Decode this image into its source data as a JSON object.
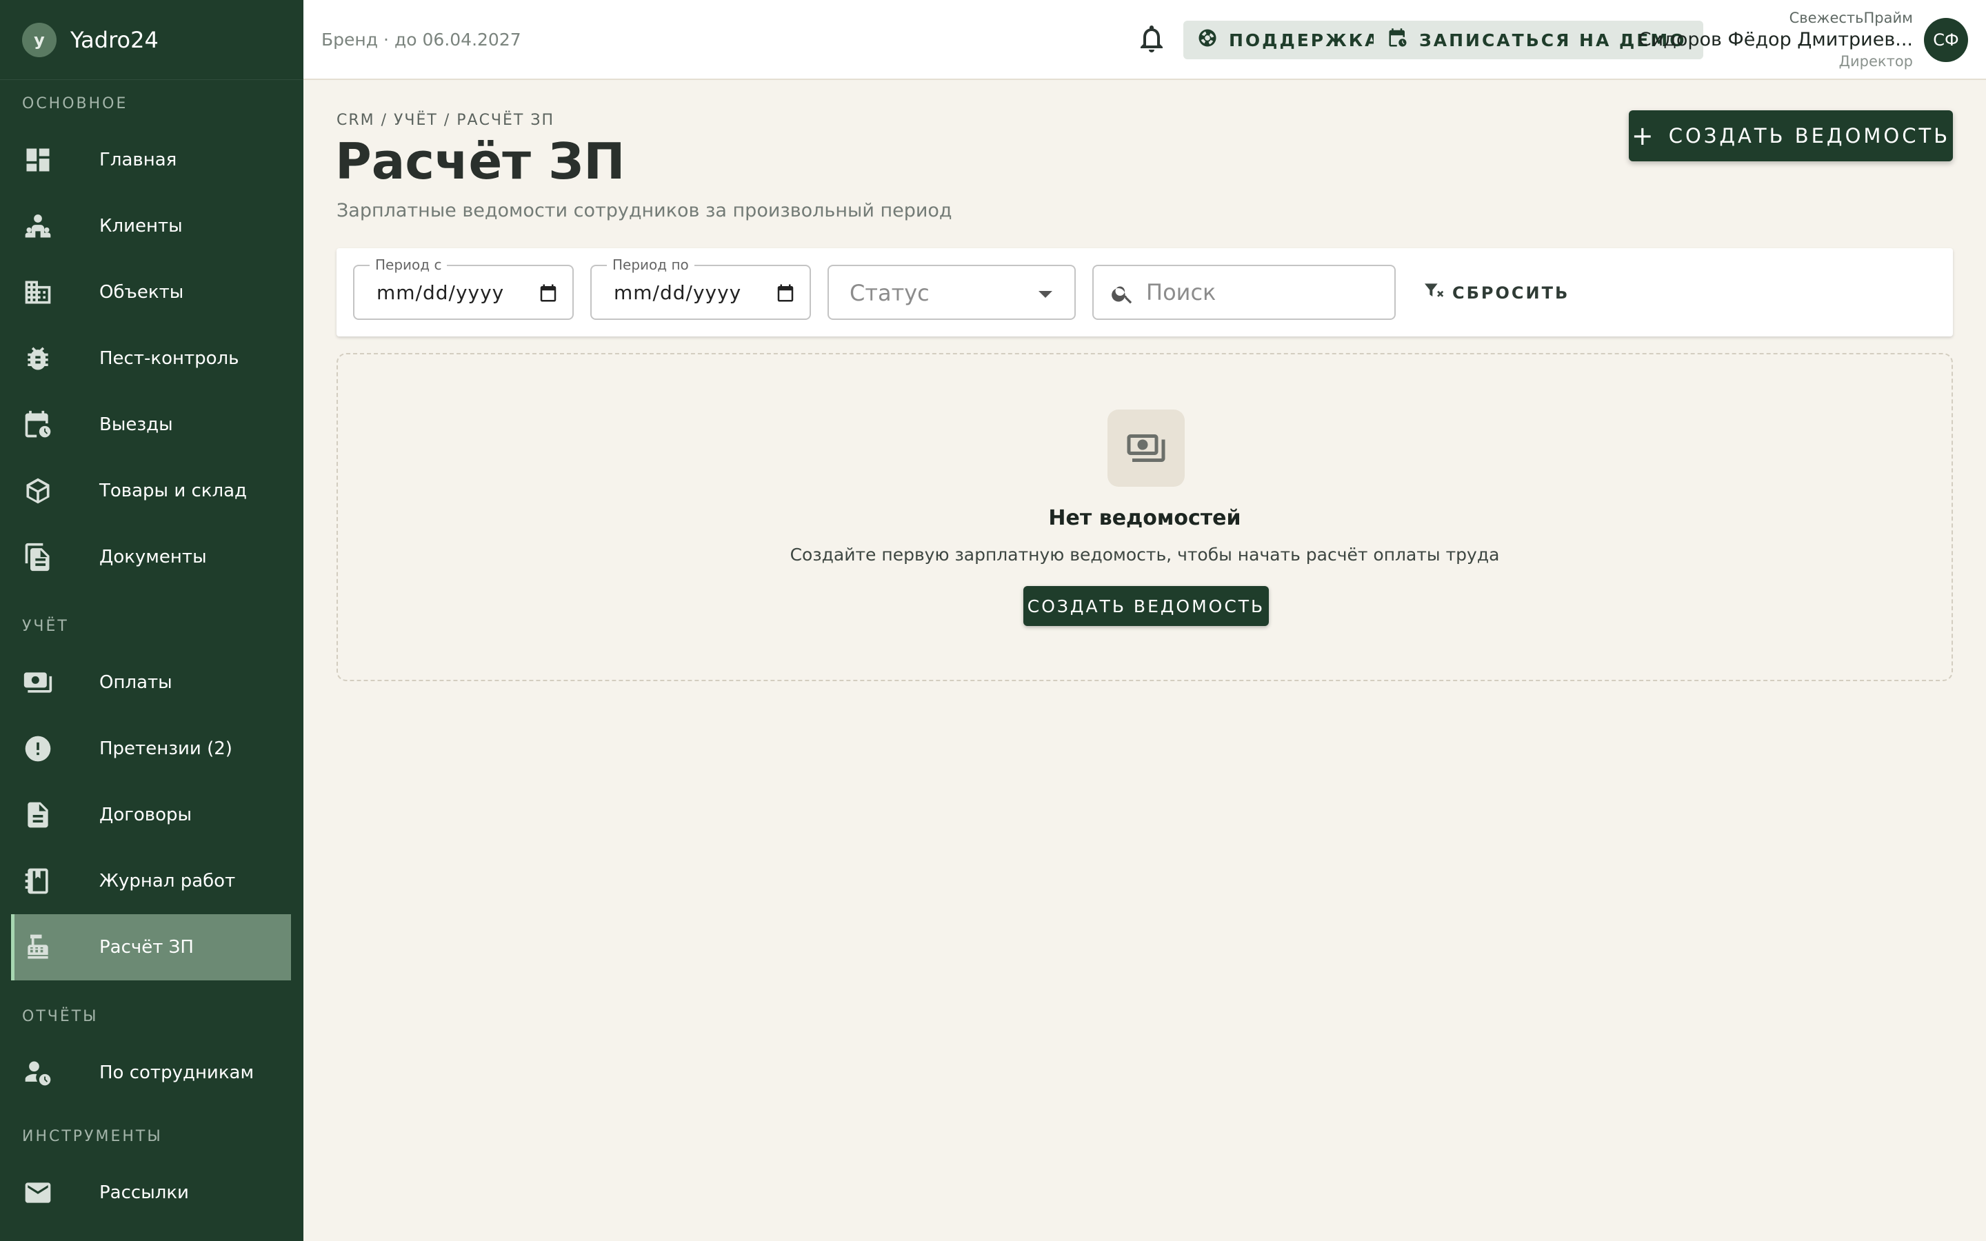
{
  "brand": {
    "logo_letter": "y",
    "name": "Yadro24"
  },
  "sidebar": {
    "sections": [
      {
        "title": "ОСНОВНОЕ"
      },
      {
        "title": "УЧЁТ"
      },
      {
        "title": "ОТЧЁТЫ"
      },
      {
        "title": "ИНСТРУМЕНТЫ"
      }
    ],
    "items": [
      {
        "label": "Главная",
        "icon": "dashboard-icon"
      },
      {
        "label": "Клиенты",
        "icon": "people-icon"
      },
      {
        "label": "Объекты",
        "icon": "building-icon"
      },
      {
        "label": "Пест-контроль",
        "icon": "bug-icon"
      },
      {
        "label": "Выезды",
        "icon": "calendar-clock-icon"
      },
      {
        "label": "Товары и склад",
        "icon": "box-icon"
      },
      {
        "label": "Документы",
        "icon": "documents-icon"
      },
      {
        "label": "Оплаты",
        "icon": "payments-icon"
      },
      {
        "label": "Претензии (2)",
        "icon": "alert-icon"
      },
      {
        "label": "Договоры",
        "icon": "contract-icon"
      },
      {
        "label": "Журнал работ",
        "icon": "journal-icon"
      },
      {
        "label": "Расчёт ЗП",
        "icon": "cash-register-icon",
        "active": true
      },
      {
        "label": "По сотрудникам",
        "icon": "person-clock-icon"
      },
      {
        "label": "Рассылки",
        "icon": "mail-icon"
      }
    ]
  },
  "topbar": {
    "brand_label": "Бренд",
    "separator": "·",
    "license": "до 06.04.2027",
    "support_label": "ПОДДЕРЖКА",
    "demo_label": "ЗАПИСАТЬСЯ НА ДЕМО",
    "user": {
      "org": "СвежестьПрайм",
      "name": "Сидоров Фёдор Дмитриев...",
      "role": "Директор",
      "initials": "СФ"
    }
  },
  "page": {
    "breadcrumb": "CRM / УЧЁТ / РАСЧЁТ ЗП",
    "title": "Расчёт ЗП",
    "subtitle": "Зарплатные ведомости сотрудников за произвольный период",
    "create_label": "СОЗДАТЬ ВЕДОМОСТЬ"
  },
  "filters": {
    "period_from_label": "Период с",
    "period_from_value": "mm/dd/yyyy",
    "period_to_label": "Период по",
    "period_to_value": "mm/dd/yyyy",
    "status_placeholder": "Статус",
    "search_placeholder": "Поиск",
    "reset_label": "СБРОСИТЬ"
  },
  "empty_state": {
    "title": "Нет ведомостей",
    "text": "Создайте первую зарплатную ведомость, чтобы начать расчёт оплаты труда",
    "button_label": "СОЗДАТЬ ВЕДОМОСТЬ"
  },
  "colors": {
    "sidebar_bg": "#1f3d2b",
    "accent": "#1f3d2b",
    "active_item_bg": "#6c8a74",
    "page_bg": "#f6f3ec"
  }
}
